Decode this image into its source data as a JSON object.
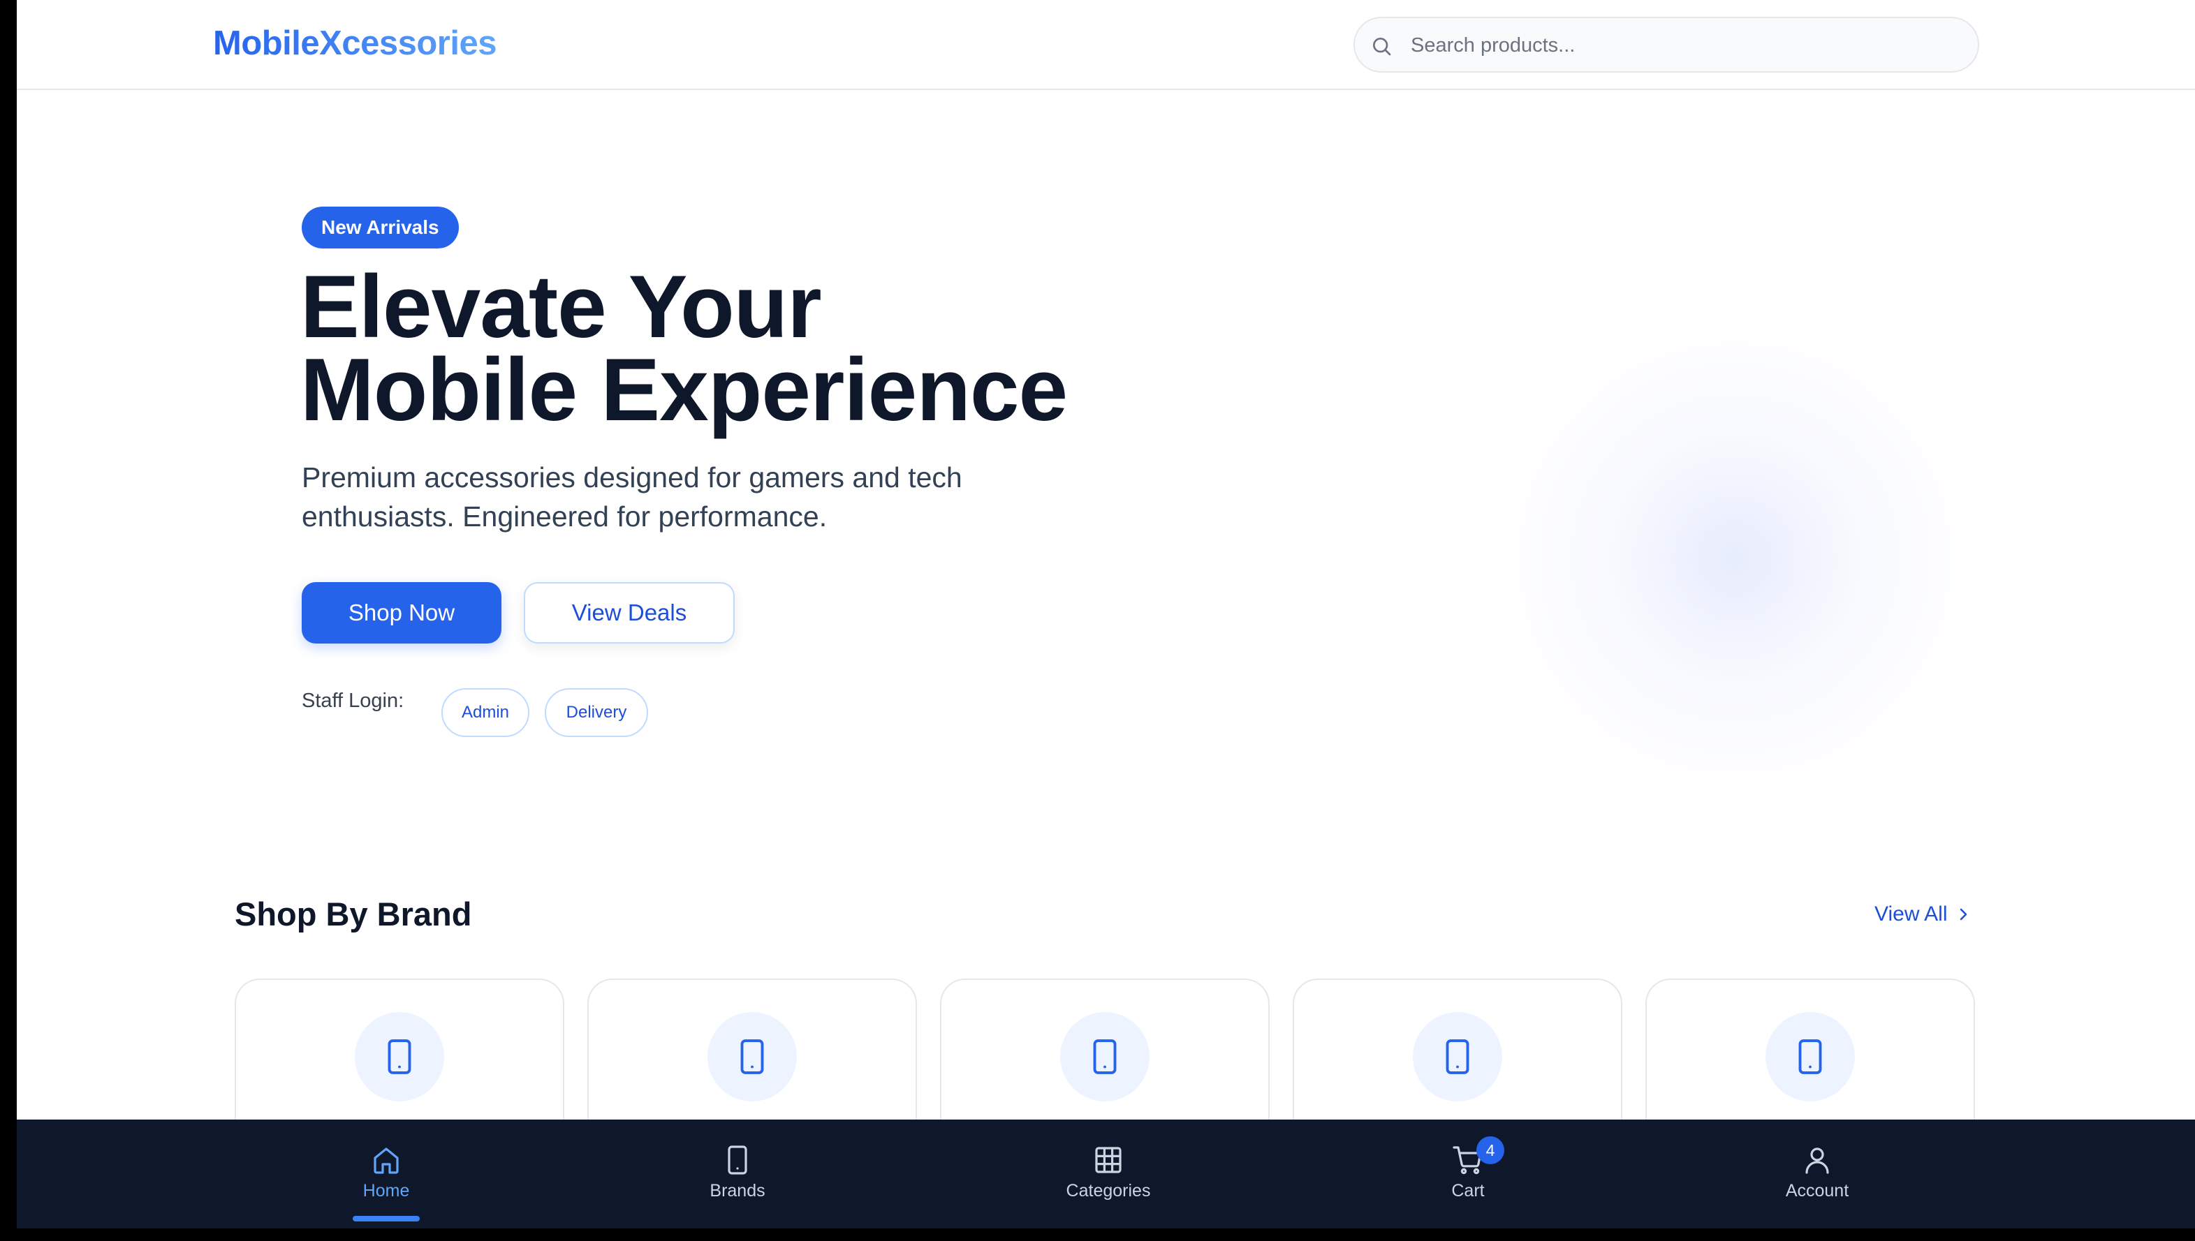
{
  "header": {
    "logo": "MobileXcessories",
    "search": {
      "placeholder": "Search products...",
      "value": ""
    }
  },
  "hero": {
    "badge": "New Arrivals",
    "title_line1": "Elevate Your",
    "title_line2": "Mobile Experience",
    "subtitle_line1": "Premium accessories designed for gamers and tech",
    "subtitle_line2": "enthusiasts. Engineered for performance.",
    "primary_button": "Shop Now",
    "secondary_button": "View Deals",
    "staff_login_label": "Staff Login:",
    "staff_buttons": [
      "Admin",
      "Delivery"
    ]
  },
  "brands_section": {
    "title": "Shop By Brand",
    "view_all": "View All",
    "cards": [
      {
        "icon": "smartphone-icon"
      },
      {
        "icon": "smartphone-icon"
      },
      {
        "icon": "smartphone-icon"
      },
      {
        "icon": "smartphone-icon"
      },
      {
        "icon": "smartphone-icon"
      }
    ]
  },
  "bottom_nav": {
    "items": [
      {
        "label": "Home",
        "icon": "home-icon",
        "active": true
      },
      {
        "label": "Brands",
        "icon": "smartphone-icon",
        "active": false
      },
      {
        "label": "Categories",
        "icon": "grid-icon",
        "active": false
      },
      {
        "label": "Cart",
        "icon": "cart-icon",
        "active": false,
        "badge": "4"
      },
      {
        "label": "Account",
        "icon": "user-icon",
        "active": false
      }
    ]
  },
  "colors": {
    "primary": "#2563eb",
    "nav_background": "#0f172a",
    "heading": "#0f172a",
    "nav_active": "#60a5fa"
  }
}
